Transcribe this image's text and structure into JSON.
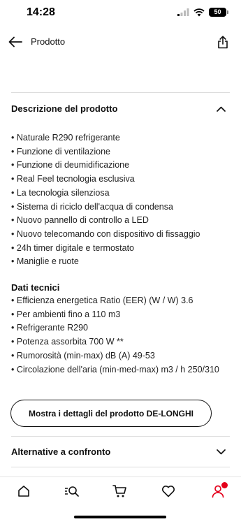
{
  "status_bar": {
    "time": "14:28",
    "battery": "50"
  },
  "header": {
    "title": "Prodotto",
    "back_icon": "arrow-left-icon",
    "share_icon": "share-icon"
  },
  "description_section": {
    "title": "Descrizione del prodotto",
    "expanded": true,
    "features": [
      "Naturale R290 refrigerante",
      "Funzione di ventilazione",
      "Funzione di deumidificazione",
      "Real Feel tecnologia esclusiva",
      "La tecnologia silenziosa",
      "Sistema di riciclo dell'acqua di condensa",
      "Nuovo pannello di controllo a LED",
      "Nuovo telecomando con dispositivo di fissaggio",
      "24h timer digitale e termostato",
      "Maniglie e ruote"
    ],
    "tech_title": "Dati tecnici",
    "tech_specs": [
      "Efficienza energetica Ratio (EER) (W / W) 3.6",
      "Per ambienti fino a 110 m3",
      "Refrigerante R290",
      "Potenza assorbita 700 W **",
      "Rumorosità (min-max) dB (A) 49-53",
      "Circolazione dell'aria (min-med-max) m3 / h 250/310"
    ],
    "details_button": "Mostra i dettagli del prodotto DE-LONGHI"
  },
  "alternatives_section": {
    "title": "Alternative a confronto",
    "expanded": false
  },
  "bottom_nav": {
    "items": [
      "home-icon",
      "search-icon",
      "cart-icon",
      "heart-icon",
      "profile-icon"
    ],
    "active": "profile-icon",
    "accent_color": "#e4001b"
  }
}
